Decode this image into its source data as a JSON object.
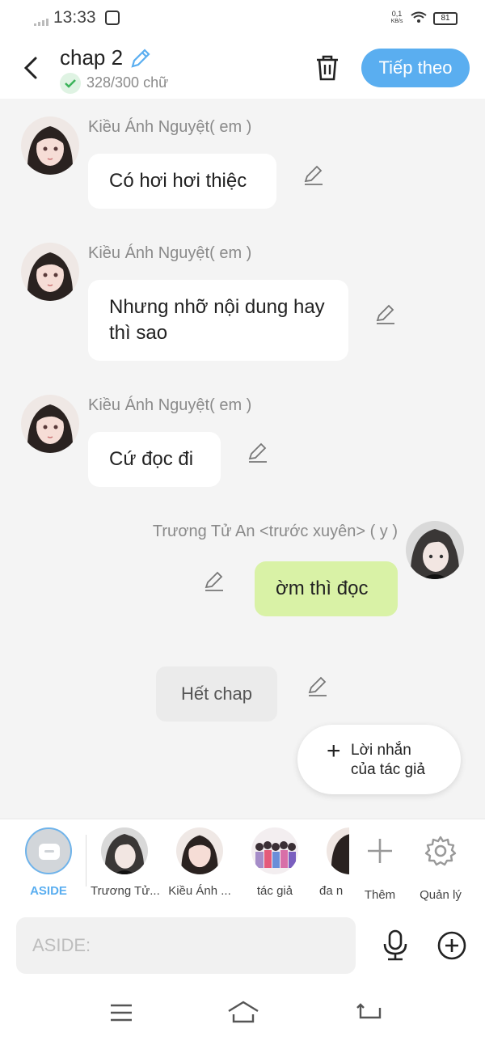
{
  "status": {
    "time": "13:33",
    "net_speed_top": "0,1",
    "net_speed_bottom": "KB/s",
    "battery": "81"
  },
  "header": {
    "title": "chap 2",
    "word_count": "328/300 chữ",
    "next_label": "Tiếp theo"
  },
  "messages": [
    {
      "sender": "Kiều Ánh Nguyệt( em )",
      "text": "Có hơi hơi thiệc",
      "side": "left"
    },
    {
      "sender": "Kiều Ánh Nguyệt( em )",
      "text": "Nhưng nhỡ nội dung hay thì sao",
      "side": "left"
    },
    {
      "sender": "Kiều Ánh Nguyệt( em )",
      "text": "Cứ đọc đi",
      "side": "left"
    },
    {
      "sender": "Trương Tử An <trước xuyên> ( y )",
      "text": "ờm thì đọc",
      "side": "right"
    }
  ],
  "end_label": "Hết chap",
  "author_note": {
    "line1": "Lời nhắn",
    "line2": "của tác giả"
  },
  "characters": [
    {
      "label": "ASIDE",
      "active": true
    },
    {
      "label": "Trương Tử..."
    },
    {
      "label": "Kiều Ánh ..."
    },
    {
      "label": "tác giả"
    },
    {
      "label": "đa n"
    }
  ],
  "actions": {
    "add_label": "Thêm",
    "manage_label": "Quản lý"
  },
  "input": {
    "placeholder": "ASIDE:"
  },
  "colors": {
    "accent": "#5aaef0",
    "own_bubble": "#d9f2a6",
    "bubble": "#ffffff",
    "background": "#f4f4f4"
  }
}
